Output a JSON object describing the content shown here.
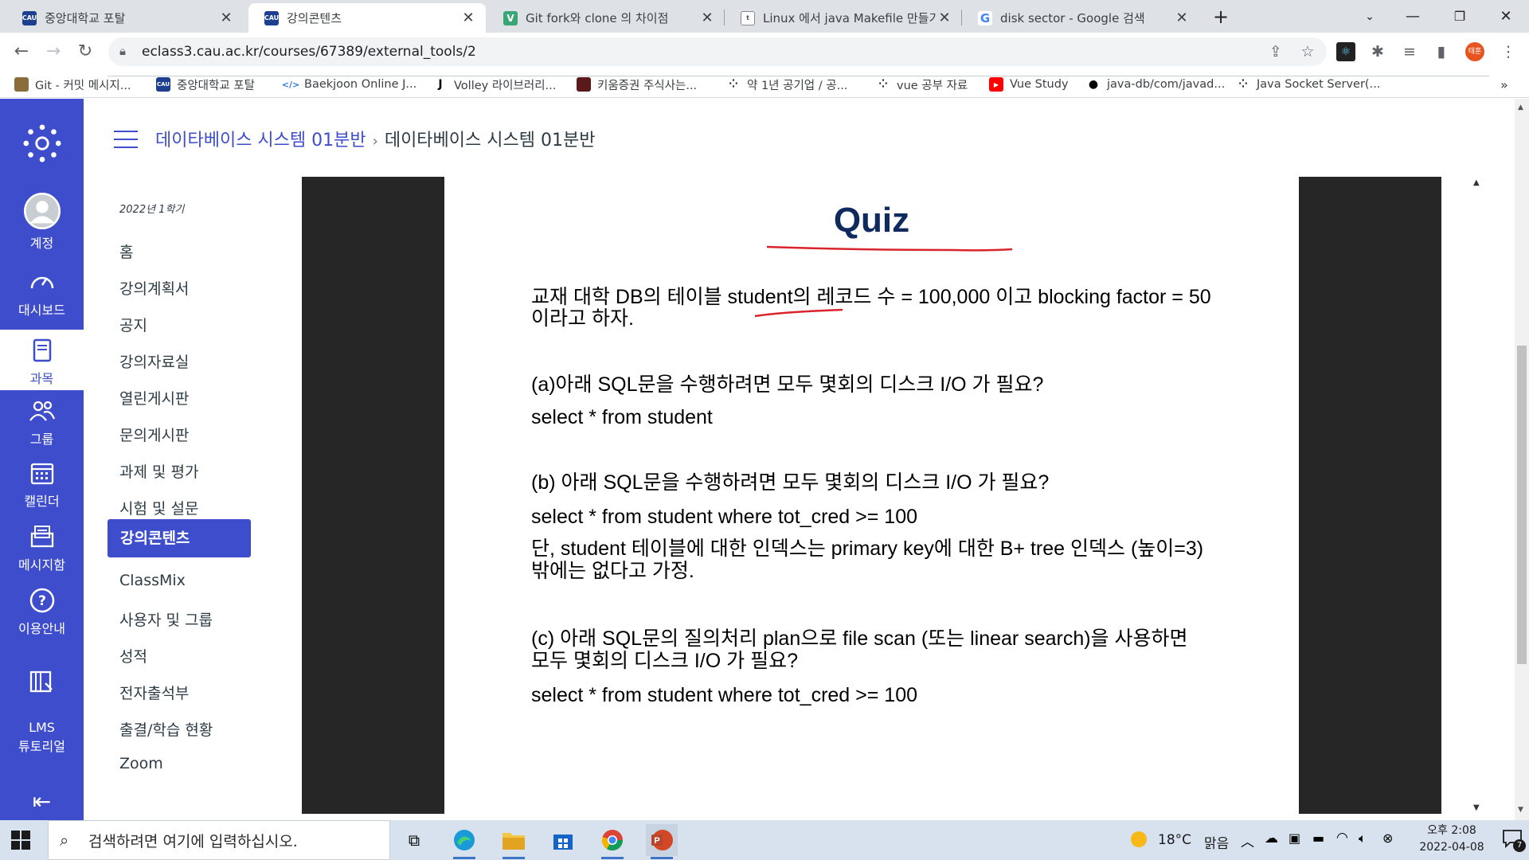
{
  "browser": {
    "tabs": [
      {
        "title": "중앙대학교 포탈",
        "favicon": "CAU",
        "active": false
      },
      {
        "title": "강의콘텐츠",
        "favicon": "CAU",
        "active": true
      },
      {
        "title": "Git fork와 clone 의 차이점",
        "favicon": "V",
        "active": false
      },
      {
        "title": "Linux 에서 java Makefile 만들기",
        "favicon": "tistory",
        "active": false
      },
      {
        "title": "disk sector - Google 검색",
        "favicon": "G",
        "active": false
      }
    ],
    "url": "eclass3.cau.ac.kr/courses/67389/external_tools/2",
    "profile_initial": "태훈",
    "bookmarks": [
      "Git - 커밋 메시지...",
      "중앙대학교 포탈",
      "Baekjoon Online J...",
      "Volley 라이브러리...",
      "키움증권 주식사는...",
      "약 1년 공기업 / 공...",
      "vue 공부 자료",
      "Vue Study",
      "java-db/com/javad...",
      "Java Socket Server(..."
    ],
    "bookmarks_more": "»"
  },
  "global_nav": {
    "items": [
      {
        "label": "계정"
      },
      {
        "label": "대시보드"
      },
      {
        "label": "과목"
      },
      {
        "label": "그룹"
      },
      {
        "label": "캘린더"
      },
      {
        "label": "메시지함"
      },
      {
        "label": "이용안내"
      },
      {
        "label": "LMS\n튜토리얼"
      }
    ],
    "collapse_icon": "⇤"
  },
  "course": {
    "breadcrumb_course": "데이타베이스 시스템 01분반",
    "breadcrumb_sep": "›",
    "breadcrumb_page": "데이타베이스 시스템 01분반",
    "term": "2022년 1학기",
    "nav": [
      "홈",
      "강의계획서",
      "공지",
      "강의자료실",
      "열린게시판",
      "문의게시판",
      "과제 및 평가",
      "시험 및 설문",
      "강의콘텐츠",
      "ClassMix",
      "사용자 및 그룹",
      "성적",
      "전자출석부",
      "출결/학습 현황",
      "Zoom"
    ],
    "nav_active_index": 8
  },
  "slide": {
    "title": "Quiz",
    "intro_line1": "교재 대학 DB의 테이블 student의 레코드 수 = 100,000 이고 blocking factor = 50",
    "intro_line2": "이라고 하자.",
    "a_question": "(a)아래 SQL문을 수행하려면 모두 몇회의 디스크 I/O 가 필요?",
    "a_sql": "select * from student",
    "b_question": "(b) 아래 SQL문을 수행하려면 모두 몇회의 디스크 I/O 가 필요?",
    "b_sql": "select * from student where tot_cred >= 100",
    "b_note1": "단, student 테이블에 대한 인덱스는 primary key에 대한 B+ tree 인덱스 (높이=3)",
    "b_note2": "밖에는 없다고 가정.",
    "c_question1": "(c) 아래 SQL문의 질의처리 plan으로 file scan (또는 linear search)을 사용하면",
    "c_question2": "모두 몇회의 디스크 I/O 가 필요?",
    "c_sql": "select * from student where tot_cred >= 100"
  },
  "taskbar": {
    "search_placeholder": "검색하려면 여기에 입력하십시오.",
    "weather_temp": "18°C",
    "weather_text": "맑음",
    "time": "오후 2:08",
    "date": "2022-04-08",
    "notification_count": "7"
  },
  "colors": {
    "canvas_blue": "#3e4dcc",
    "slide_title": "#0e2a5e",
    "annotation_red": "#d9242b"
  }
}
